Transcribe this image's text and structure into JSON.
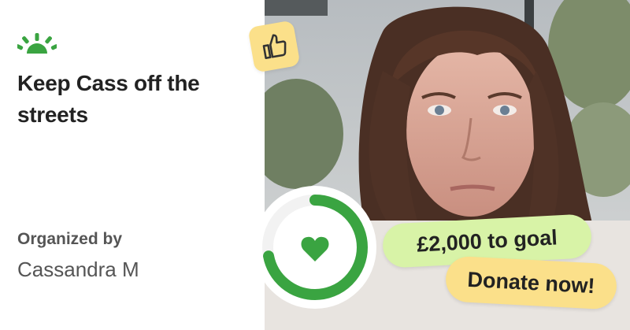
{
  "campaign": {
    "title": "Keep Cass off the streets",
    "organized_label": "Organized by",
    "organizer": "Cassandra M"
  },
  "progress": {
    "goal_text": "£2,000 to goal",
    "fraction": 0.72
  },
  "cta": {
    "donate_label": "Donate now!"
  },
  "icons": {
    "logo": "sunrise-logo-icon",
    "thumb": "thumbs-up-icon",
    "heart": "heart-icon"
  },
  "colors": {
    "brand_green": "#3aa441",
    "goal_pill": "#d8f3a7",
    "donate_yellow": "#fbe08a",
    "ring_track": "#f2f2f2"
  }
}
